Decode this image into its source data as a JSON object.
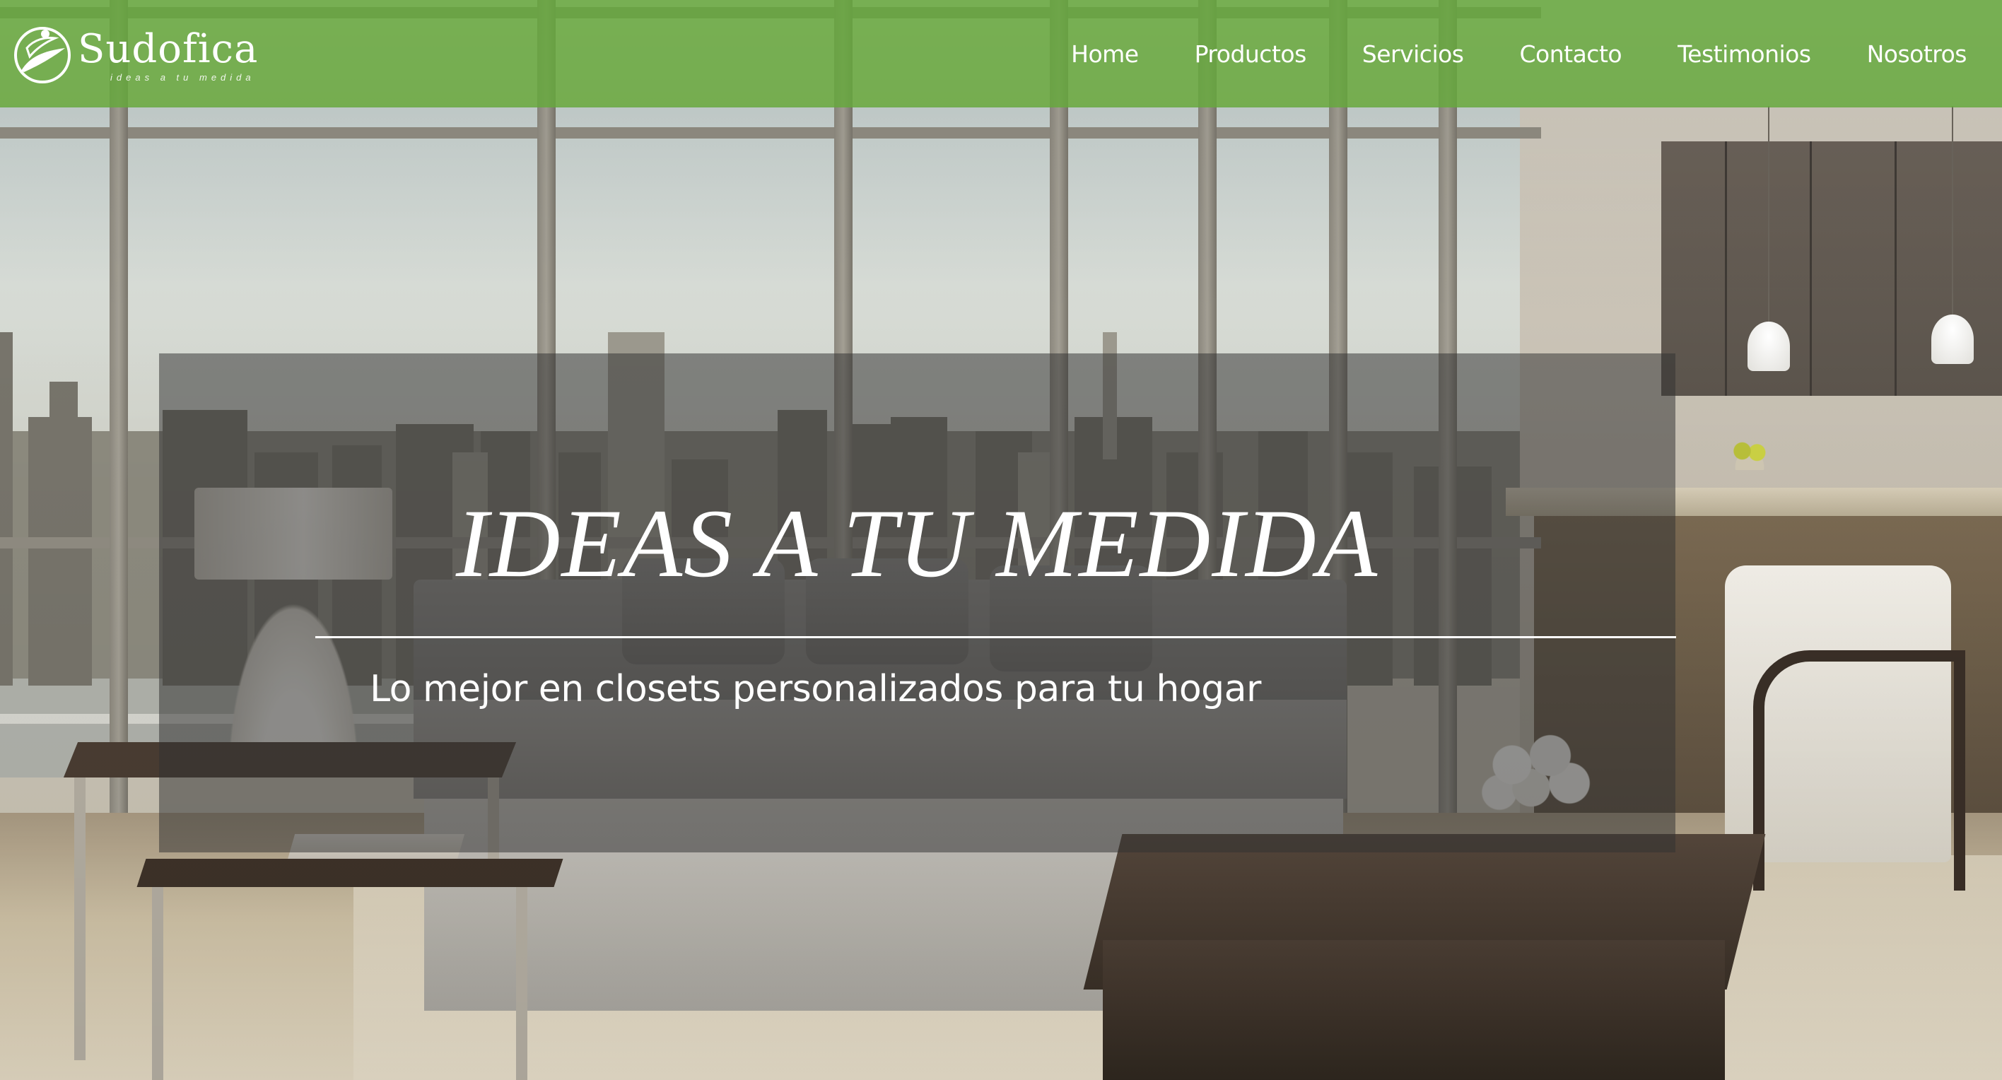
{
  "brand": {
    "name": "Sudofica",
    "tagline": "ideas a tu medida",
    "nav_color": "#66a83e"
  },
  "nav": {
    "items": [
      {
        "label": "Home"
      },
      {
        "label": "Productos"
      },
      {
        "label": "Servicios"
      },
      {
        "label": "Contacto"
      },
      {
        "label": "Testimonios"
      },
      {
        "label": "Nosotros"
      }
    ]
  },
  "hero": {
    "title": "IDEAS A TU MEDIDA",
    "subtitle": "Lo mejor en closets personalizados para tu hogar",
    "background": "living-room-city-view-photo"
  },
  "icons": {
    "logo": "leaf-circle-logo-icon"
  }
}
